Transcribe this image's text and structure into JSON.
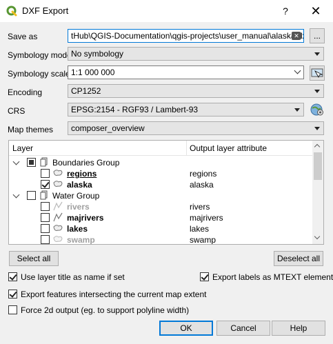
{
  "window": {
    "title": "DXF Export",
    "help": "?",
    "close": "✕"
  },
  "form": {
    "save_as_label": "Save as",
    "save_as_value": "tHub\\QGIS-Documentation\\qgis-projects\\user_manual\\alaska.dxf",
    "browse_label": "...",
    "symbology_mode_label": "Symbology mode",
    "symbology_mode_value": "No symbology",
    "symbology_scale_label": "Symbology scale",
    "symbology_scale_value": "1:1 000 000",
    "encoding_label": "Encoding",
    "encoding_value": "CP1252",
    "crs_label": "CRS",
    "crs_value": "EPSG:2154 - RGF93 / Lambert-93",
    "map_themes_label": "Map themes",
    "map_themes_value": "composer_overview"
  },
  "tree": {
    "col_layer": "Layer",
    "col_attr": "Output layer attribute",
    "rows": [
      {
        "label": "Boundaries Group",
        "attr": ""
      },
      {
        "label": "regions",
        "attr": "regions"
      },
      {
        "label": "alaska",
        "attr": "alaska"
      },
      {
        "label": "Water Group",
        "attr": ""
      },
      {
        "label": "rivers",
        "attr": "rivers"
      },
      {
        "label": "majrivers",
        "attr": "majrivers"
      },
      {
        "label": "lakes",
        "attr": "lakes"
      },
      {
        "label": "swamp",
        "attr": "swamp"
      }
    ]
  },
  "buttons": {
    "select_all": "Select all",
    "deselect_all": "Deselect all",
    "ok": "OK",
    "cancel": "Cancel",
    "help": "Help"
  },
  "options": {
    "layer_title": "Use layer title as name if set",
    "mtext": "Export labels as MTEXT elements",
    "intersect": "Export features intersecting the current map extent",
    "force2d": "Force 2d output (eg. to support polyline width)"
  },
  "colors": {
    "qgis_green": "#589632",
    "qgis_yellow": "#eebe1b"
  }
}
